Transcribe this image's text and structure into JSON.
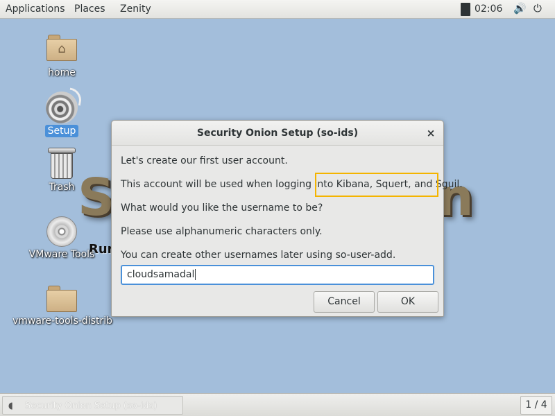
{
  "top_panel": {
    "menus": [
      "Applications",
      "Places",
      "Zenity"
    ],
    "clock": "02:06",
    "icons": {
      "volume": "volume-icon",
      "power": "power-icon"
    }
  },
  "desktop": {
    "background": {
      "logo_left": "S",
      "logo_right": "n",
      "run_text": "Run",
      "tail_text": "."
    },
    "icons": [
      {
        "label": "home",
        "icon": "home-folder-icon"
      },
      {
        "label": "Setup",
        "icon": "setup-icon",
        "selected": true
      },
      {
        "label": "Trash",
        "icon": "trash-icon"
      },
      {
        "label": "VMware Tools",
        "icon": "cd-icon"
      },
      {
        "label": "vmware-tools-distrib",
        "icon": "folder-icon"
      }
    ]
  },
  "dialog": {
    "title": "Security Onion Setup (so-ids)",
    "close_symbol": "×",
    "lines": [
      "Let's create our first user account.",
      "This account will be used when logging into Kibana, Squert, and Sguil.",
      "What would you like the username to be?",
      "Please use alphanumeric characters only.",
      "You can create other usernames later using so-user-add."
    ],
    "input_value": "cloudsamadal",
    "buttons": {
      "cancel": "Cancel",
      "ok": "OK"
    },
    "highlight_color": "#f4b400"
  },
  "bottom_panel": {
    "task_label": "Security Onion Setup (so-ids)",
    "workspace": "1 / 4"
  },
  "colors": {
    "desktop": "#a3bedb",
    "accent": "#4a90d9"
  }
}
